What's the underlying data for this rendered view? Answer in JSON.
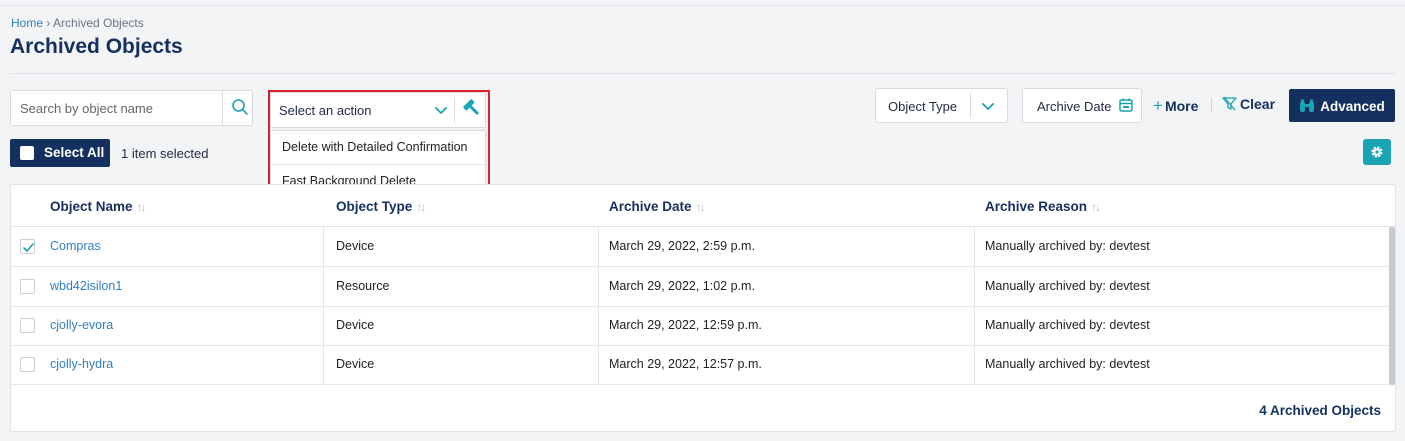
{
  "breadcrumb": {
    "home": "Home",
    "sep": " › ",
    "current": "Archived Objects"
  },
  "page_title": "Archived Objects",
  "search": {
    "placeholder": "Search by object name",
    "value": ""
  },
  "action_select": {
    "label": "Select an action",
    "options": [
      "Delete with Detailed Confirmation",
      "Fast Background Delete"
    ]
  },
  "filters": {
    "object_type": "Object Type",
    "archive_date": "Archive Date",
    "more": "More",
    "clear": "Clear",
    "advanced": "Advanced"
  },
  "selection": {
    "select_all": "Select All",
    "count_text": "1 item selected"
  },
  "table": {
    "columns": [
      "Object Name",
      "Object Type",
      "Archive Date",
      "Archive Reason"
    ],
    "rows": [
      {
        "checked": true,
        "name": "Compras",
        "type": "Device",
        "date": "March 29, 2022, 2:59 p.m.",
        "reason": "Manually archived by: devtest"
      },
      {
        "checked": false,
        "name": "wbd42isilon1",
        "type": "Resource",
        "date": "March 29, 2022, 1:02 p.m.",
        "reason": "Manually archived by: devtest"
      },
      {
        "checked": false,
        "name": "cjolly-evora",
        "type": "Device",
        "date": "March 29, 2022, 12:59 p.m.",
        "reason": "Manually archived by: devtest"
      },
      {
        "checked": false,
        "name": "cjolly-hydra",
        "type": "Device",
        "date": "March 29, 2022, 12:57 p.m.",
        "reason": "Manually archived by: devtest"
      }
    ],
    "footer": "4 Archived Objects"
  },
  "icons": {
    "search": "search-icon",
    "chevron": "chevron-down-icon",
    "hammer": "hammer-icon",
    "calendar": "calendar-icon",
    "filter_clear": "filter-clear-icon",
    "binoculars": "binoculars-icon",
    "gear": "gear-icon",
    "check": "check-icon"
  },
  "colors": {
    "brand": "#14305f",
    "accent": "#1aa3b3",
    "link": "#2f7fc1",
    "highlight": "#d9242f"
  }
}
